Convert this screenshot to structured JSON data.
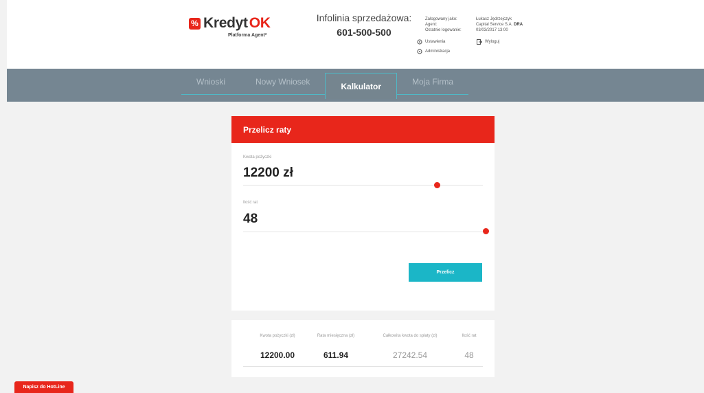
{
  "brand": {
    "name": "Kredyt",
    "name_accent": "OK",
    "subtitle": "Platforma Agent*",
    "mark": "%"
  },
  "hotline": {
    "label": "Infolinia sprzedażowa:",
    "number": "601-500-500"
  },
  "user": {
    "logged_label": "Zalogowany jako:",
    "logged_value": "Łukasz Jędrzejczyk",
    "role_label": "Agent:",
    "role_value": "Capital Service S.A.",
    "role_code": "DRA",
    "last_login_label": "Ostatnie logowanie:",
    "last_login_value": "03/03/2017 13:00",
    "settings_label": "Ustawienia",
    "admin_label": "Administracja",
    "logout_label": "Wyloguj"
  },
  "nav": {
    "tabs": [
      {
        "label": "Wnioski"
      },
      {
        "label": "Nowy Wniosek"
      },
      {
        "label": "Kalkulator"
      },
      {
        "label": "Moja Firma"
      }
    ],
    "active_index": 2
  },
  "calculator": {
    "title": "Przelicz raty",
    "amount_label": "Kwota pożyczki",
    "amount_value": "12200 zł",
    "installments_label": "Ilość rat",
    "installments_value": "48",
    "button_label": "Przelicz"
  },
  "results": {
    "headers": [
      "Kwota pożyczki (zł)",
      "Rata miesięczna (zł)",
      "Całkowita kwota do spłaty (zł)",
      "Ilość rat"
    ],
    "values": [
      "12200.00",
      "611.94",
      "27242.54",
      "48"
    ]
  },
  "hotline_button": {
    "label": "Napisz do HotLine"
  },
  "colors": {
    "brand_red": "#e8261b",
    "nav_bg": "#758692",
    "accent_teal": "#1bb6c7"
  }
}
